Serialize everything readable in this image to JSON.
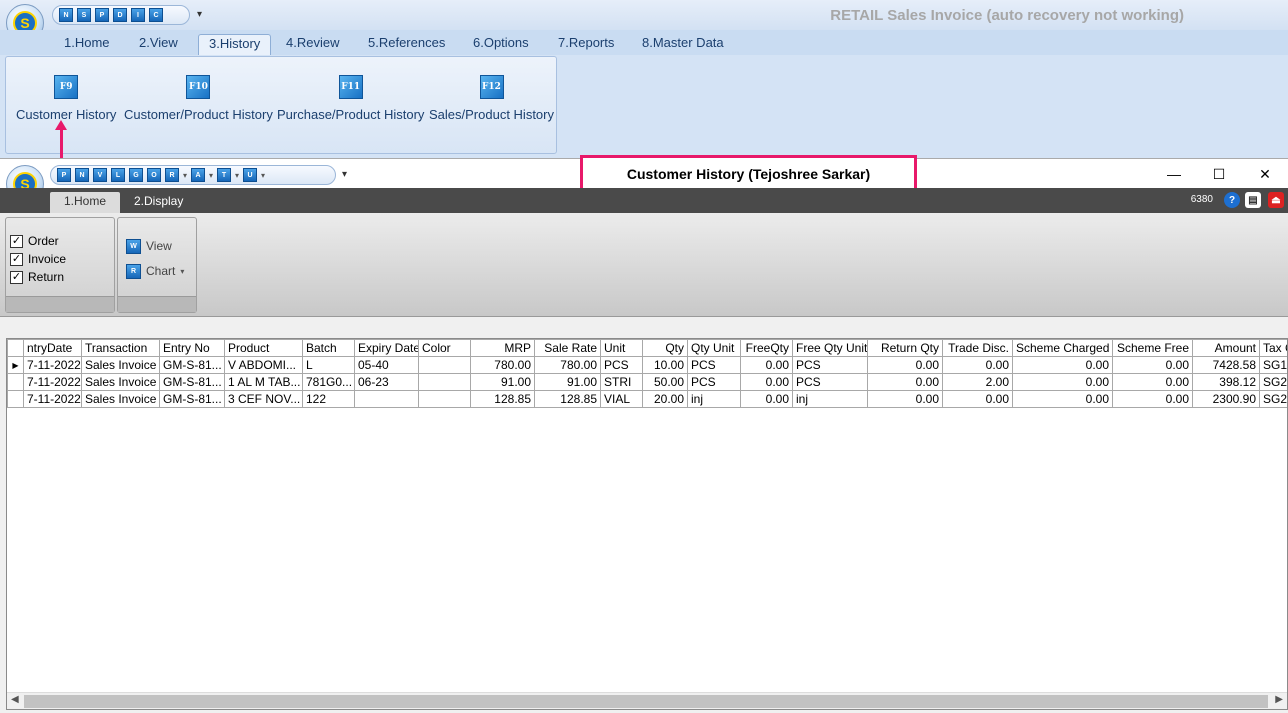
{
  "back_window": {
    "title": "RETAIL Sales Invoice (auto recovery not working)",
    "quick_access": [
      "N",
      "S",
      "P",
      "D",
      "I",
      "C"
    ],
    "tabs": [
      "1.Home",
      "2.View",
      "3.History",
      "4.Review",
      "5.References",
      "6.Options",
      "7.Reports",
      "8.Master Data"
    ],
    "active_tab": "3.History",
    "ribbon_items": [
      {
        "key": "F9",
        "label": "Customer History"
      },
      {
        "key": "F10",
        "label": "Customer/Product History"
      },
      {
        "key": "F11",
        "label": "Purchase/Product History"
      },
      {
        "key": "F12",
        "label": "Sales/Product History"
      }
    ]
  },
  "front_window": {
    "title": "Customer History (Tejoshree Sarkar)",
    "quick_access": [
      "P",
      "N",
      "V",
      "L",
      "G",
      "O",
      "R",
      "A",
      "T",
      "U"
    ],
    "tabs": [
      "1.Home",
      "2.Display"
    ],
    "active_tab": "1.Home",
    "status_number": "6380",
    "filters": [
      {
        "label": "Order",
        "checked": true
      },
      {
        "label": "Invoice",
        "checked": true
      },
      {
        "label": "Return",
        "checked": true
      }
    ],
    "actions": {
      "view": "View",
      "chart": "Chart"
    }
  },
  "grid": {
    "columns": [
      "ntryDate",
      "Transaction",
      "Entry No",
      "Product",
      "Batch",
      "Expiry Date",
      "Color",
      "MRP",
      "Sale Rate",
      "Unit",
      "Qty",
      "Qty Unit",
      "FreeQty",
      "Free Qty Unit",
      "Return Qty",
      "Trade Disc.",
      "Scheme Charged",
      "Scheme Free",
      "Amount",
      "Tax Co"
    ],
    "rows": [
      [
        "7-11-2022",
        "Sales Invoice",
        "GM-S-81...",
        "V ABDOMI...",
        "L",
        "05-40",
        "",
        "780.00",
        "780.00",
        "PCS",
        "10.00",
        "PCS",
        "0.00",
        "PCS",
        "0.00",
        "0.00",
        "0.00",
        "0.00",
        "7428.58",
        "SG1"
      ],
      [
        "7-11-2022",
        "Sales Invoice",
        "GM-S-81...",
        "1 AL M TAB...",
        "781G0...",
        "06-23",
        "",
        "91.00",
        "91.00",
        "STRI",
        "50.00",
        "PCS",
        "0.00",
        "PCS",
        "0.00",
        "2.00",
        "0.00",
        "0.00",
        "398.12",
        "SG2"
      ],
      [
        "7-11-2022",
        "Sales Invoice",
        "GM-S-81...",
        "3 CEF NOV...",
        "122",
        "",
        "",
        "128.85",
        "128.85",
        "VIAL",
        "20.00",
        "inj",
        "0.00",
        "inj",
        "0.00",
        "0.00",
        "0.00",
        "0.00",
        "2300.90",
        "SG2"
      ]
    ]
  }
}
